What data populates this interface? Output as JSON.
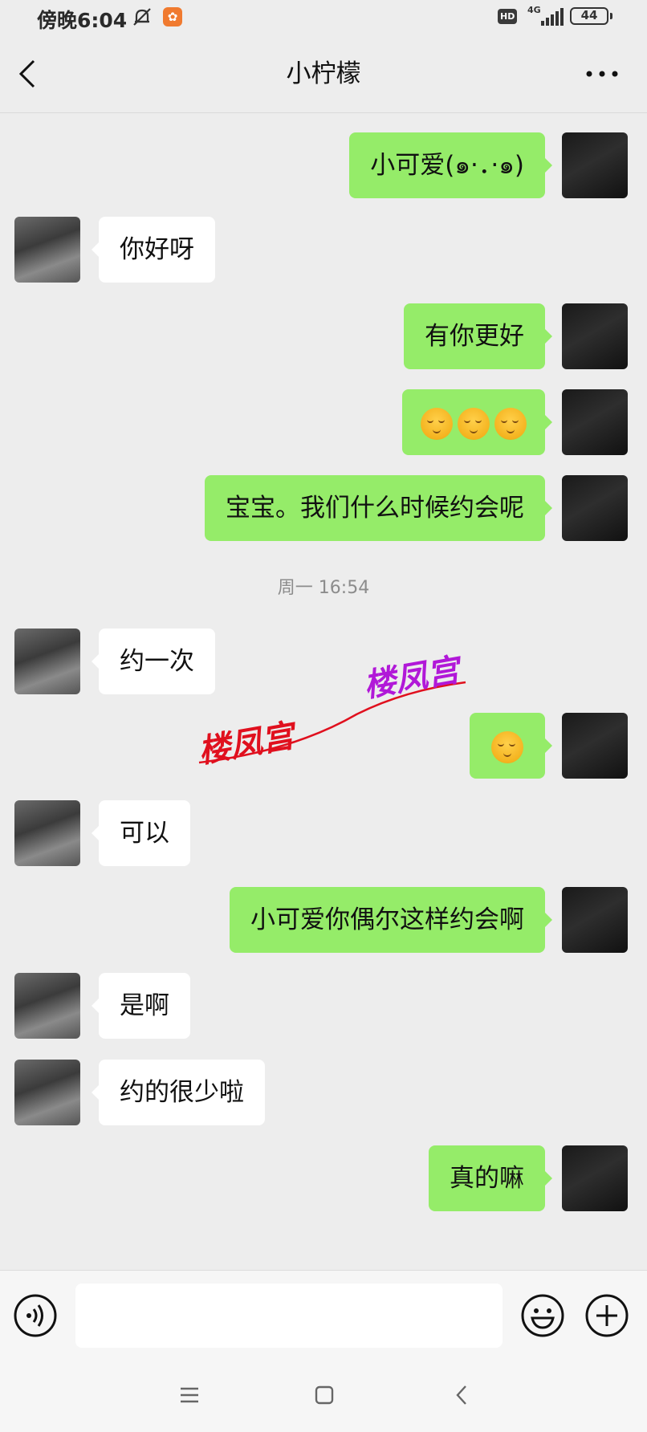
{
  "status_bar": {
    "time": "傍晚6:04",
    "hd": "HD",
    "network": "4G",
    "battery": "44"
  },
  "header": {
    "title": "小柠檬",
    "back_icon": "chevron-left-icon",
    "more_icon": "more-dots-icon"
  },
  "messages": [
    {
      "side": "right",
      "text": "小可爱(๑·．·๑)"
    },
    {
      "side": "left",
      "text": "你好呀"
    },
    {
      "side": "right",
      "text": "有你更好"
    },
    {
      "side": "right",
      "text": "",
      "emoji_count": 3
    },
    {
      "side": "right",
      "text": "宝宝。我们什么时候约会呢"
    },
    {
      "side": "left",
      "text": "约一次"
    },
    {
      "side": "right",
      "text": "",
      "emoji_count": 1
    },
    {
      "side": "left",
      "text": "可以"
    },
    {
      "side": "right",
      "text": "小可爱你偶尔这样约会啊"
    },
    {
      "side": "left",
      "text": "是啊"
    },
    {
      "side": "left",
      "text": "约的很少啦"
    },
    {
      "side": "right",
      "text": "真的嘛"
    }
  ],
  "timestamp": "周一 16:54",
  "watermark": {
    "text_1": "楼凤宫",
    "text_2": "楼凤宫",
    "color_1": "#e0101e",
    "color_2": "#b118d8"
  },
  "input_bar": {
    "placeholder": "",
    "voice_icon": "voice-icon",
    "emoji_icon": "emoji-icon",
    "plus_icon": "plus-icon"
  },
  "colors": {
    "sent_bubble": "#95ec69",
    "received_bubble": "#ffffff",
    "background": "#ededed"
  }
}
